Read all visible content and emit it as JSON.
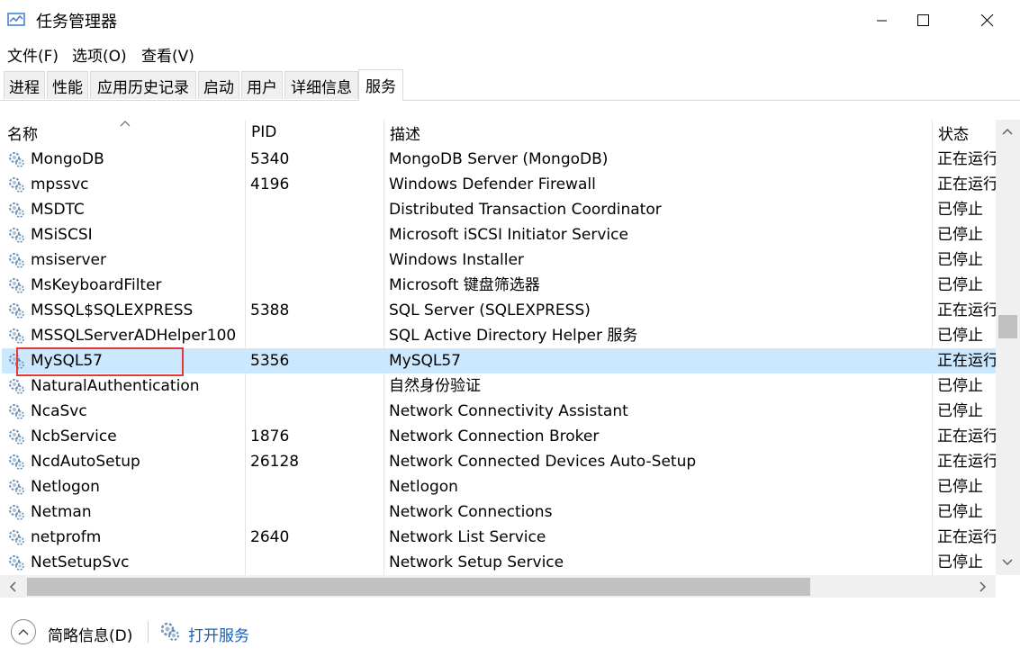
{
  "window": {
    "title": "任务管理器"
  },
  "menu": [
    "文件(F)",
    "选项(O)",
    "查看(V)"
  ],
  "tabs": [
    "进程",
    "性能",
    "应用历史记录",
    "启动",
    "用户",
    "详细信息",
    "服务"
  ],
  "active_tab": "服务",
  "columns": {
    "name": "名称",
    "pid": "PID",
    "desc": "描述",
    "status": "状态"
  },
  "rows": [
    {
      "name": "MongoDB",
      "pid": "5340",
      "desc": "MongoDB Server (MongoDB)",
      "status": "正在运行"
    },
    {
      "name": "mpssvc",
      "pid": "4196",
      "desc": "Windows Defender Firewall",
      "status": "正在运行"
    },
    {
      "name": "MSDTC",
      "pid": "",
      "desc": "Distributed Transaction Coordinator",
      "status": "已停止"
    },
    {
      "name": "MSiSCSI",
      "pid": "",
      "desc": "Microsoft iSCSI Initiator Service",
      "status": "已停止"
    },
    {
      "name": "msiserver",
      "pid": "",
      "desc": "Windows Installer",
      "status": "已停止"
    },
    {
      "name": "MsKeyboardFilter",
      "pid": "",
      "desc": "Microsoft 键盘筛选器",
      "status": "已停止"
    },
    {
      "name": "MSSQL$SQLEXPRESS",
      "pid": "5388",
      "desc": "SQL Server (SQLEXPRESS)",
      "status": "正在运行"
    },
    {
      "name": "MSSQLServerADHelper100",
      "pid": "",
      "desc": "SQL Active Directory Helper 服务",
      "status": "已停止"
    },
    {
      "name": "MySQL57",
      "pid": "5356",
      "desc": "MySQL57",
      "status": "正在运行",
      "selected": true
    },
    {
      "name": "NaturalAuthentication",
      "pid": "",
      "desc": "自然身份验证",
      "status": "已停止"
    },
    {
      "name": "NcaSvc",
      "pid": "",
      "desc": "Network Connectivity Assistant",
      "status": "已停止"
    },
    {
      "name": "NcbService",
      "pid": "1876",
      "desc": "Network Connection Broker",
      "status": "正在运行"
    },
    {
      "name": "NcdAutoSetup",
      "pid": "26128",
      "desc": "Network Connected Devices Auto-Setup",
      "status": "正在运行"
    },
    {
      "name": "Netlogon",
      "pid": "",
      "desc": "Netlogon",
      "status": "已停止"
    },
    {
      "name": "Netman",
      "pid": "",
      "desc": "Network Connections",
      "status": "已停止"
    },
    {
      "name": "netprofm",
      "pid": "2640",
      "desc": "Network List Service",
      "status": "正在运行"
    },
    {
      "name": "NetSetupSvc",
      "pid": "",
      "desc": "Network Setup Service",
      "status": "已停止"
    }
  ],
  "footer": {
    "fewer_details": "简略信息(D)",
    "open_services": "打开服务"
  },
  "colors": {
    "selection": "#cce8ff",
    "highlight_box": "#e53935",
    "link": "#1560bd"
  },
  "icons": [
    "task-manager-icon",
    "minimize-icon",
    "maximize-icon",
    "close-icon",
    "service-gear-icon",
    "chevron-up-icon",
    "scroll-up-icon",
    "scroll-down-icon",
    "scroll-left-icon",
    "scroll-right-icon"
  ]
}
